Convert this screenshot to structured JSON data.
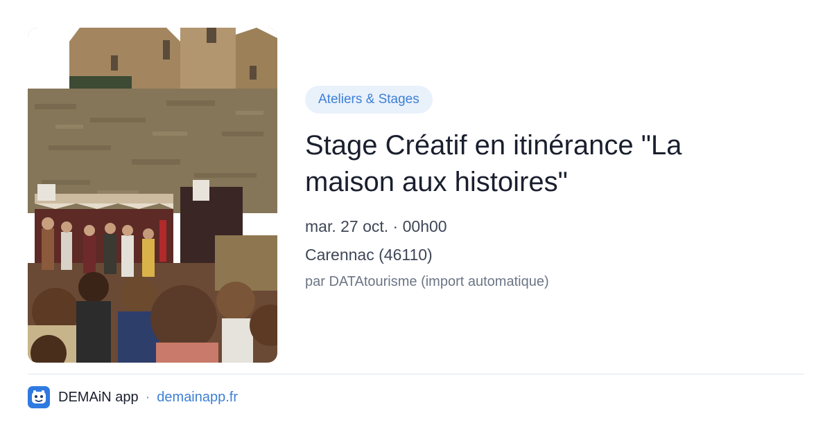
{
  "card": {
    "image": {
      "alt": "",
      "subject": "castle-wall-outdoor-theatre-photo"
    },
    "category": "Ateliers & Stages",
    "title": "Stage Créatif en itinérance \"La maison aux histoires\"",
    "date": "mar. 27 oct. · 00h00",
    "location": "Carennac (46110)",
    "source": "par DATAtourisme (import automatique)"
  },
  "footer": {
    "app_name": "DEMAiN app",
    "separator": "·",
    "domain": "demainapp.fr",
    "icon": "demain-app-icon"
  },
  "colors": {
    "accent": "#3d7fd4",
    "badge_bg": "#e9f1fb",
    "title": "#1a1f2e",
    "meta": "#3e4656",
    "muted": "#6b7585",
    "divider": "#dfe6ec"
  }
}
